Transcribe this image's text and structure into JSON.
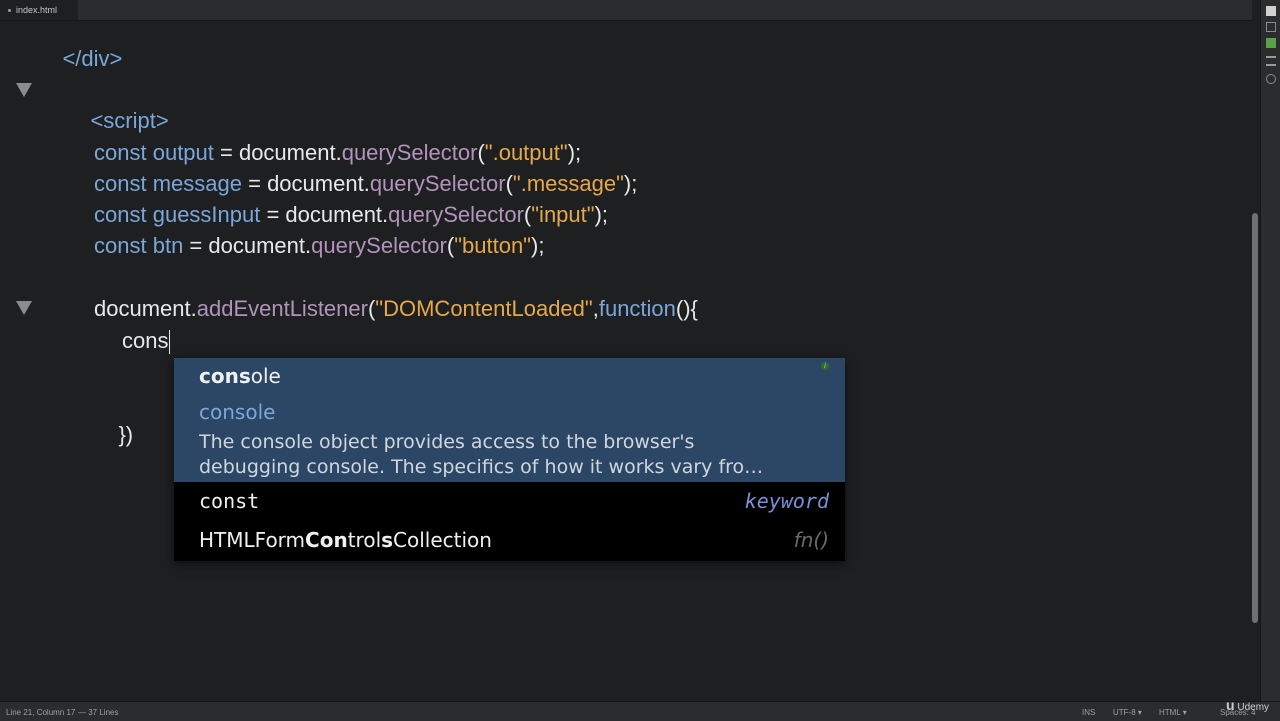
{
  "tab": {
    "label": "index.html"
  },
  "code": {
    "line_div": "</div>",
    "line_script": "<script>",
    "decl1": {
      "kw": "const",
      "name": "output",
      "eq": " = document.",
      "fn": "querySelector",
      "open": "(",
      "str": "\".output\"",
      "close": ");"
    },
    "decl2": {
      "kw": "const",
      "name": "message",
      "eq": " = document.",
      "fn": "querySelector",
      "open": "(",
      "str": "\".message\"",
      "close": ");"
    },
    "decl3": {
      "kw": "const",
      "name": "guessInput",
      "eq": " = document.",
      "fn": "querySelector",
      "open": "(",
      "str": "\"input\"",
      "close": ");"
    },
    "decl4": {
      "kw": "const",
      "name": "btn",
      "eq": " = document.",
      "fn": "querySelector",
      "open": "(",
      "str": "\"button\"",
      "close": ");"
    },
    "listener": {
      "obj": "document.",
      "fn": "addEventListener",
      "open": "(",
      "str": "\"DOMContentLoaded\"",
      "comma": ",",
      "kw": "function",
      "rest": "(){"
    },
    "typed": "cons",
    "close_brace": "})"
  },
  "autocomplete": {
    "selected": {
      "match": "cons",
      "rest": "ole",
      "type": "console",
      "info_icon": "info-icon",
      "description_line1": "The console object provides access to the browser's",
      "description_line2": "debugging console. The specifics of how it works vary fro…"
    },
    "items": [
      {
        "label": "const",
        "kind": "keyword",
        "kind_color": "#7a8fd8"
      },
      {
        "label_pre": "HTMLForm",
        "label_bold1": "Con",
        "label_mid": "trol",
        "label_bold2": "s",
        "label_post": "Collection",
        "kind": "fn()",
        "kind_color": "#6a6a6a"
      }
    ]
  },
  "status": {
    "position": "Line 21, Column 17",
    "lines": "— 37 Lines",
    "mode": "INS",
    "encoding": "UTF-8 ▾",
    "language": "HTML ▾",
    "spaces": "Spaces: 4"
  },
  "watermark": {
    "brand": "Udemy"
  },
  "colors": {
    "background": "#1d1f21",
    "keyword": "#7aa6da",
    "function": "#b294bb",
    "string": "#e6a84a",
    "selection": "#2c4766"
  }
}
